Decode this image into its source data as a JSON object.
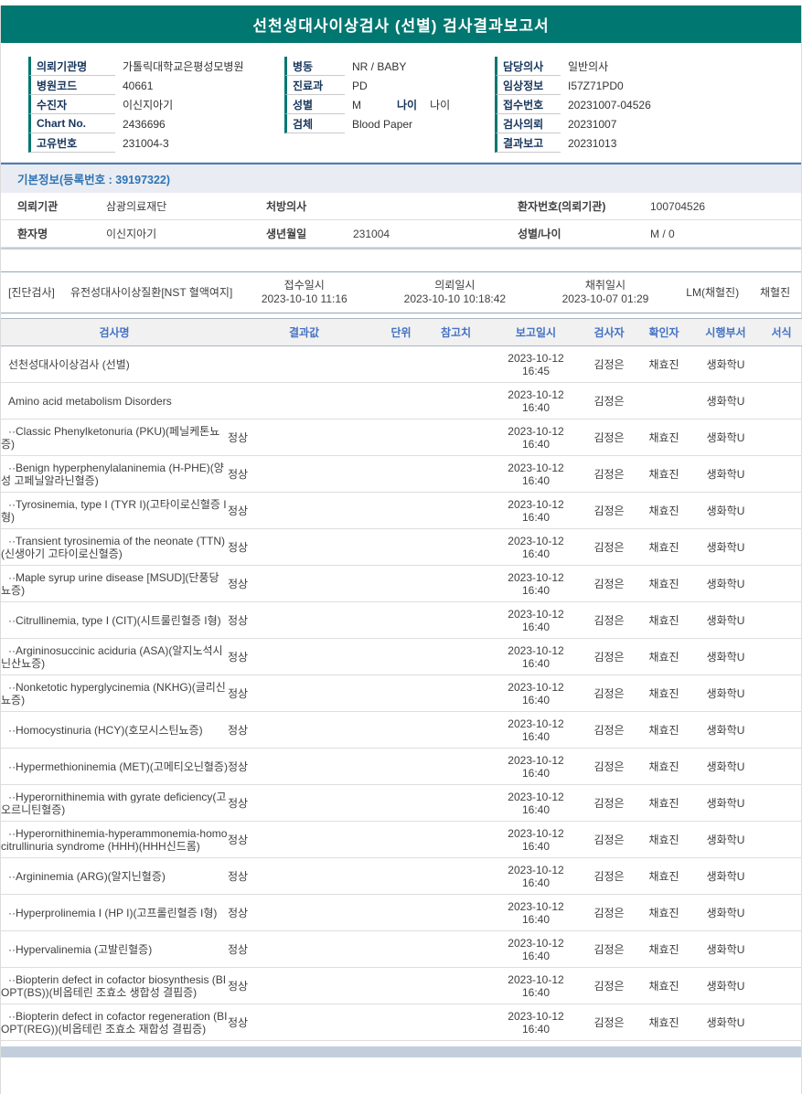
{
  "colors": {
    "brand_teal": "#007770",
    "section_blue": "#2e74b5",
    "table_header_blue": "#4472c4"
  },
  "header": {
    "title": "선천성대사이상검사 (선별) 검사결과보고서"
  },
  "patient_info": {
    "col1": [
      {
        "label": "의뢰기관명",
        "value": "가톨릭대학교은평성모병원"
      },
      {
        "label": "병원코드",
        "value": "40661"
      },
      {
        "label": "수진자",
        "value": "이신지아기"
      },
      {
        "label": "Chart No.",
        "value": "2436696"
      },
      {
        "label": "고유번호",
        "value": "231004-3"
      }
    ],
    "col2": [
      {
        "label": "병동",
        "value": "NR / BABY"
      },
      {
        "label": "진료과",
        "value": "PD"
      },
      {
        "label": "성별",
        "value": "M",
        "label2": "나이",
        "value2": "나이"
      },
      {
        "label": "검체",
        "value": "Blood Paper"
      }
    ],
    "col3": [
      {
        "label": "담당의사",
        "value": "일반의사"
      },
      {
        "label": "임상정보",
        "value": "I57Z71PD0"
      },
      {
        "label": "접수번호",
        "value": "20231007-04526"
      },
      {
        "label": "검사의뢰",
        "value": "20231007"
      },
      {
        "label": "결과보고",
        "value": "20231013"
      }
    ]
  },
  "basic_info": {
    "header": "기본정보(등록번호 : 39197322)",
    "rows": [
      {
        "l1": "의뢰기관",
        "v1": "삼광의료재단",
        "l2": "처방의사",
        "v2": "",
        "l3": "환자번호(의뢰기관)",
        "v3": "100704526"
      },
      {
        "l1": "환자명",
        "v1": "이신지아기",
        "l2": "생년월일",
        "v2": "231004",
        "l3": "성별/나이",
        "v3": "M / 0"
      }
    ]
  },
  "diagnosis": {
    "section_label": "[진단검사]",
    "test_name": "유전성대사이상질환[NST 혈액여지]",
    "receipt_label": "접수일시",
    "receipt_time": "2023-10-10 11:16",
    "request_label": "의뢰일시",
    "request_time": "2023-10-10 10:18:42",
    "collect_label": "채취일시",
    "collect_time": "2023-10-07 01:29",
    "collector": "LM(채혈진)",
    "phlebotomist": "채혈진"
  },
  "results": {
    "headers": [
      "검사명",
      "결과값",
      "단위",
      "참고치",
      "보고일시",
      "검사자",
      "확인자",
      "시행부서",
      "서식"
    ],
    "rows": [
      {
        "name": "선천성대사이상검사 (선별)",
        "date": "2023-10-12",
        "time": "16:45",
        "tester": "김정은",
        "confirmer": "채효진",
        "dept": "생화학U"
      },
      {
        "name": "Amino acid metabolism Disorders",
        "date": "2023-10-12",
        "time": "16:40",
        "tester": "김정은",
        "dept": "생화학U"
      },
      {
        "name": "··Classic Phenylketonuria (PKU)(페닐케톤뇨증)",
        "result": "정상",
        "date": "2023-10-12",
        "time": "16:40",
        "tester": "김정은",
        "confirmer": "채효진",
        "dept": "생화학U"
      },
      {
        "name": "··Benign hyperphenylalaninemia (H-PHE)(양성 고페닐알라닌혈증)",
        "result": "정상",
        "date": "2023-10-12",
        "time": "16:40",
        "tester": "김정은",
        "confirmer": "채효진",
        "dept": "생화학U"
      },
      {
        "name": "··Tyrosinemia, type I (TYR I)(고타이로신혈증 I형)",
        "result": "정상",
        "date": "2023-10-12",
        "time": "16:40",
        "tester": "김정은",
        "confirmer": "채효진",
        "dept": "생화학U"
      },
      {
        "name": "··Transient tyrosinemia of the neonate (TTN)(신생아기 고타이로신혈증)",
        "result": "정상",
        "date": "2023-10-12",
        "time": "16:40",
        "tester": "김정은",
        "confirmer": "채효진",
        "dept": "생화학U"
      },
      {
        "name": "··Maple syrup urine disease [MSUD](단풍당뇨증)",
        "result": "정상",
        "date": "2023-10-12",
        "time": "16:40",
        "tester": "김정은",
        "confirmer": "채효진",
        "dept": "생화학U"
      },
      {
        "name": "··Citrullinemia, type I (CIT)(시트룰린혈증 I형)",
        "result": "정상",
        "date": "2023-10-12",
        "time": "16:40",
        "tester": "김정은",
        "confirmer": "채효진",
        "dept": "생화학U"
      },
      {
        "name": "··Argininosuccinic aciduria (ASA)(알지노석시닌산뇨증)",
        "result": "정상",
        "date": "2023-10-12",
        "time": "16:40",
        "tester": "김정은",
        "confirmer": "채효진",
        "dept": "생화학U"
      },
      {
        "name": "··Nonketotic hyperglycinemia (NKHG)(글리신뇨증)",
        "result": "정상",
        "date": "2023-10-12",
        "time": "16:40",
        "tester": "김정은",
        "confirmer": "채효진",
        "dept": "생화학U"
      },
      {
        "name": "··Homocystinuria (HCY)(호모시스틴뇨증)",
        "result": "정상",
        "date": "2023-10-12",
        "time": "16:40",
        "tester": "김정은",
        "confirmer": "채효진",
        "dept": "생화학U"
      },
      {
        "name": "··Hypermethioninemia (MET)(고메티오닌혈증)",
        "result": "정상",
        "date": "2023-10-12",
        "time": "16:40",
        "tester": "김정은",
        "confirmer": "채효진",
        "dept": "생화학U"
      },
      {
        "name": "··Hyperornithinemia with gyrate deficiency(고오르니틴혈증)",
        "result": "정상",
        "date": "2023-10-12",
        "time": "16:40",
        "tester": "김정은",
        "confirmer": "채효진",
        "dept": "생화학U"
      },
      {
        "name": "··Hyperornithinemia-hyperammonemia-homocitrullinuria syndrome (HHH)(HHH신드롬)",
        "result": "정상",
        "date": "2023-10-12",
        "time": "16:40",
        "tester": "김정은",
        "confirmer": "채효진",
        "dept": "생화학U"
      },
      {
        "name": "··Argininemia (ARG)(알지닌혈증)",
        "result": "정상",
        "date": "2023-10-12",
        "time": "16:40",
        "tester": "김정은",
        "confirmer": "채효진",
        "dept": "생화학U"
      },
      {
        "name": "··Hyperprolinemia I (HP I)(고프롤린혈증 I형)",
        "result": "정상",
        "date": "2023-10-12",
        "time": "16:40",
        "tester": "김정은",
        "confirmer": "채효진",
        "dept": "생화학U"
      },
      {
        "name": "··Hypervalinemia (고발린혈증)",
        "result": "정상",
        "date": "2023-10-12",
        "time": "16:40",
        "tester": "김정은",
        "confirmer": "채효진",
        "dept": "생화학U"
      },
      {
        "name": "··Biopterin defect in cofactor biosynthesis (BIOPT(BS))(비옵테린 조효소 생합성 결핍증)",
        "result": "정상",
        "date": "2023-10-12",
        "time": "16:40",
        "tester": "김정은",
        "confirmer": "채효진",
        "dept": "생화학U"
      },
      {
        "name": "··Biopterin defect in cofactor regeneration (BIOPT(REG))(비옵테린 조효소 재합성 결핍증)",
        "result": "정상",
        "date": "2023-10-12",
        "time": "16:40",
        "tester": "김정은",
        "confirmer": "채효진",
        "dept": "생화학U"
      }
    ]
  }
}
